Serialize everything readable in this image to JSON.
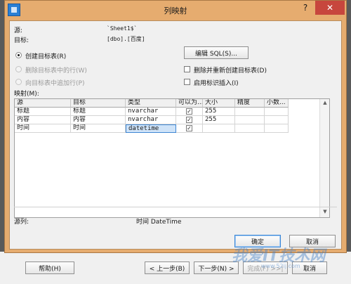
{
  "dialog": {
    "title": "列映射"
  },
  "source": {
    "label": "源:",
    "value": "`Sheet1$`"
  },
  "target": {
    "label": "目标:",
    "value": "[dbo].[百度]"
  },
  "options": {
    "create_table": "创建目标表(R)",
    "delete_rows": "删除目标表中的行(W)",
    "append_rows": "向目标表中追加行(P)",
    "edit_sql": "编辑 SQL(S)...",
    "drop_recreate": "删除并重新创建目标表(D)",
    "enable_identity": "启用标识插入(I)"
  },
  "mappings": {
    "label": "映射(M):",
    "columns": [
      "源",
      "目标",
      "类型",
      "可以为...",
      "大小",
      "精度",
      "小数..."
    ],
    "rows": [
      {
        "source": "标题",
        "target": "标题",
        "type": "nvarchar",
        "nullable": true,
        "size": "255",
        "precision": "",
        "scale": ""
      },
      {
        "source": "内容",
        "target": "内容",
        "type": "nvarchar",
        "nullable": true,
        "size": "255",
        "precision": "",
        "scale": ""
      },
      {
        "source": "时间",
        "target": "时间",
        "type": "datetime",
        "nullable": true,
        "size": "",
        "precision": "",
        "scale": ""
      }
    ]
  },
  "source_column": {
    "label": "源列:",
    "value": "时间 DateTime"
  },
  "buttons": {
    "ok": "确定",
    "cancel": "取消"
  },
  "wizard": {
    "help": "帮助(H)",
    "back": "< 上一步(B)",
    "next": "下一步(N) >",
    "finish": "完成(F) >>|",
    "cancel": "取消"
  },
  "watermark": {
    "main": "我爱IT技术网",
    "sub": "www.52ij.com"
  },
  "colors": {
    "title_bar": "#e6ac6f",
    "close": "#c7463d",
    "selection": "#cfe3f8"
  },
  "icons": [
    "app-icon",
    "help-icon",
    "close-icon",
    "check-icon"
  ]
}
